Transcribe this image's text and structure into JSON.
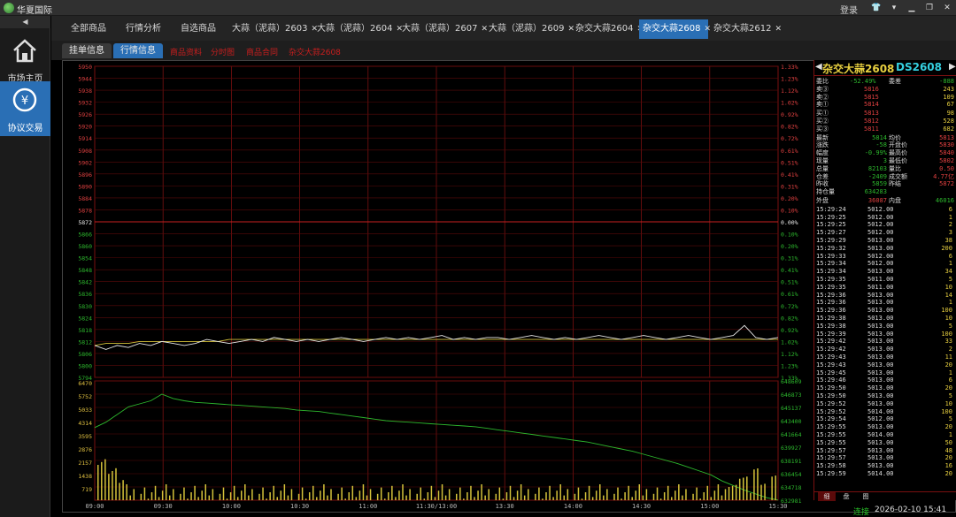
{
  "app": {
    "title": "华夏国际",
    "login": "登录"
  },
  "sidebar": {
    "toggle": "◀",
    "items": [
      {
        "label": "市场主页"
      },
      {
        "label": "协议交易"
      }
    ]
  },
  "tabs": [
    {
      "label": "全部商品",
      "closable": false
    },
    {
      "label": "行情分析",
      "closable": false
    },
    {
      "label": "自选商品",
      "closable": false
    },
    {
      "label": "大蒜（泥蒜）2603",
      "closable": true
    },
    {
      "label": "大蒜（泥蒜）2604",
      "closable": true
    },
    {
      "label": "大蒜（泥蒜）2607",
      "closable": true
    },
    {
      "label": "大蒜（泥蒜）2609",
      "closable": true
    },
    {
      "label": "杂交大蒜2604",
      "closable": true
    },
    {
      "label": "杂交大蒜2608",
      "closable": true,
      "active": true
    },
    {
      "label": "杂交大蒜2612",
      "closable": true
    }
  ],
  "subtabs": {
    "order": "挂单信息",
    "quote": "行情信息",
    "links": [
      "商品资料",
      "分时图",
      "商品合同",
      "杂交大蒜2608"
    ]
  },
  "chart_data": {
    "type": "line",
    "price_axis": {
      "labels": [
        "5950",
        "5944",
        "5938",
        "5932",
        "5926",
        "5920",
        "5914",
        "5908",
        "5902",
        "5896",
        "5890",
        "5884",
        "5878",
        "5872",
        "5866",
        "5860",
        "5854",
        "5848",
        "5842",
        "5836",
        "5830",
        "5824",
        "5818",
        "5812",
        "5806",
        "5800",
        "5794"
      ],
      "pct": [
        "1.33%",
        "1.23%",
        "1.12%",
        "1.02%",
        "0.92%",
        "0.82%",
        "0.72%",
        "0.61%",
        "0.51%",
        "0.41%",
        "0.31%",
        "0.20%",
        "0.10%",
        "0.00%",
        "0.10%",
        "0.20%",
        "0.31%",
        "0.41%",
        "0.51%",
        "0.61%",
        "0.72%",
        "0.82%",
        "0.92%",
        "1.02%",
        "1.12%",
        "1.23%",
        "1.33%"
      ],
      "center": "5872"
    },
    "volume_axis": {
      "left": [
        "6470",
        "5752",
        "5033",
        "4314",
        "3595",
        "2876",
        "2157",
        "1438",
        "719"
      ],
      "right": [
        "648609",
        "646873",
        "645137",
        "643400",
        "641664",
        "639927",
        "638191",
        "636454",
        "634718",
        "632981"
      ]
    },
    "time_labels": [
      "09:00",
      "09:30",
      "10:00",
      "10:30",
      "11:00",
      "11:30/13:00",
      "13:30",
      "14:00",
      "14:30",
      "15:00",
      "15:30"
    ],
    "price_series": [
      5810,
      5808,
      5810,
      5809,
      5811,
      5810,
      5812,
      5811,
      5810,
      5811,
      5813,
      5812,
      5811,
      5812,
      5813,
      5812,
      5814,
      5813,
      5812,
      5813,
      5812,
      5813,
      5814,
      5813,
      5812,
      5813,
      5814,
      5813,
      5814,
      5813,
      5814,
      5815,
      5813,
      5814,
      5813,
      5814,
      5814,
      5813,
      5814,
      5815,
      5814,
      5813,
      5814,
      5813,
      5814,
      5815,
      5814,
      5813,
      5814,
      5815,
      5814,
      5813,
      5814,
      5815,
      5814,
      5813,
      5814,
      5815,
      5820,
      5814,
      5813,
      5814
    ],
    "avg_series": [
      5810,
      5811,
      5811,
      5811,
      5812,
      5812,
      5812,
      5812,
      5812,
      5812,
      5812,
      5812,
      5813,
      5813,
      5813,
      5813,
      5813,
      5813,
      5813,
      5813,
      5813,
      5813,
      5813,
      5813,
      5813,
      5813,
      5813,
      5813,
      5813,
      5813,
      5813,
      5813,
      5813,
      5813,
      5813,
      5813,
      5813,
      5813,
      5813,
      5813,
      5813,
      5813,
      5813,
      5813,
      5813,
      5813,
      5813,
      5813,
      5813,
      5813,
      5813,
      5813,
      5813,
      5813,
      5813,
      5813,
      5813,
      5813,
      5813,
      5813,
      5813,
      5813
    ],
    "oi_series": [
      642500,
      643200,
      644200,
      645200,
      645600,
      646000,
      646873,
      646300,
      646000,
      645800,
      645700,
      645600,
      645500,
      645400,
      645300,
      645200,
      645100,
      645000,
      644800,
      644700,
      644600,
      644400,
      644200,
      644000,
      643800,
      643600,
      643400,
      643300,
      643200,
      643100,
      643000,
      642900,
      642800,
      642700,
      642600,
      642400,
      642200,
      642000,
      641800,
      641600,
      641400,
      641200,
      641000,
      640800,
      640600,
      640300,
      640000,
      639700,
      639400,
      639000,
      638600,
      638200,
      637800,
      637300,
      636800,
      636300,
      635500,
      634900,
      634300,
      633800,
      633300,
      633000
    ]
  },
  "quote": {
    "name": "杂交大蒜2608",
    "code": "DS2608",
    "diff": {
      "k1": "委比",
      "v1": "-52.49%",
      "k2": "委差",
      "v2": "-888"
    },
    "asks": [
      {
        "k": "卖③",
        "p": "5816",
        "v": "243"
      },
      {
        "k": "卖②",
        "p": "5815",
        "v": "109"
      },
      {
        "k": "卖①",
        "p": "5814",
        "v": "67"
      }
    ],
    "bids": [
      {
        "k": "买①",
        "p": "5813",
        "v": "98"
      },
      {
        "k": "买②",
        "p": "5812",
        "v": "528"
      },
      {
        "k": "买③",
        "p": "5811",
        "v": "682"
      }
    ],
    "stats": [
      [
        "最新",
        "5814",
        "均价",
        "5813"
      ],
      [
        "涨跌",
        "-58",
        "开盘价",
        "5830"
      ],
      [
        "幅度",
        "-0.99%",
        "最高价",
        "5840"
      ],
      [
        "现量",
        "3",
        "最低价",
        "5802"
      ],
      [
        "总量",
        "82103",
        "量比",
        "0.50"
      ],
      [
        "仓差",
        "-2409",
        "成交额",
        "4.77亿"
      ],
      [
        "昨收",
        "5859",
        "昨结",
        "5872"
      ],
      [
        "持仓量",
        "634283",
        "",
        ""
      ]
    ],
    "outer": {
      "k1": "外盘",
      "v1": "36087",
      "k2": "内盘",
      "v2": "46016"
    },
    "ticks": [
      [
        "15:29:24",
        "5012.00",
        "6"
      ],
      [
        "15:29:25",
        "5012.00",
        "1"
      ],
      [
        "15:29:25",
        "5012.00",
        "2"
      ],
      [
        "15:29:27",
        "5012.00",
        "3"
      ],
      [
        "15:29:29",
        "5013.00",
        "38"
      ],
      [
        "15:29:32",
        "5013.00",
        "200"
      ],
      [
        "15:29:33",
        "5012.00",
        "6"
      ],
      [
        "15:29:34",
        "5012.00",
        "1"
      ],
      [
        "15:29:34",
        "5013.00",
        "34"
      ],
      [
        "15:29:35",
        "5011.00",
        "5"
      ],
      [
        "15:29:35",
        "5011.00",
        "10"
      ],
      [
        "15:29:36",
        "5013.00",
        "14"
      ],
      [
        "15:29:36",
        "5013.00",
        "1"
      ],
      [
        "15:29:36",
        "5013.00",
        "100"
      ],
      [
        "15:29:38",
        "5013.00",
        "10"
      ],
      [
        "15:29:38",
        "5013.00",
        "5"
      ],
      [
        "15:29:39",
        "5013.00",
        "100"
      ],
      [
        "15:29:42",
        "5013.00",
        "33"
      ],
      [
        "15:29:42",
        "5013.00",
        "2"
      ],
      [
        "15:29:43",
        "5013.00",
        "11"
      ],
      [
        "15:29:43",
        "5013.00",
        "20"
      ],
      [
        "15:29:45",
        "5013.00",
        "1"
      ],
      [
        "15:29:46",
        "5013.00",
        "6"
      ],
      [
        "15:29:50",
        "5013.00",
        "20"
      ],
      [
        "15:29:50",
        "5013.00",
        "5"
      ],
      [
        "15:29:52",
        "5013.00",
        "10"
      ],
      [
        "15:29:52",
        "5014.00",
        "100"
      ],
      [
        "15:29:54",
        "5012.00",
        "5"
      ],
      [
        "15:29:55",
        "5013.00",
        "20"
      ],
      [
        "15:29:55",
        "5014.00",
        "1"
      ],
      [
        "15:29:55",
        "5013.00",
        "50"
      ],
      [
        "15:29:57",
        "5013.00",
        "48"
      ],
      [
        "15:29:57",
        "5013.00",
        "20"
      ],
      [
        "15:29:58",
        "5013.00",
        "16"
      ],
      [
        "15:29:59",
        "5014.00",
        "20"
      ]
    ],
    "bottom_tabs": [
      "细",
      "盘",
      "图"
    ]
  },
  "status": {
    "conn": "连接",
    "datetime": "2026-02-10  15:41"
  }
}
